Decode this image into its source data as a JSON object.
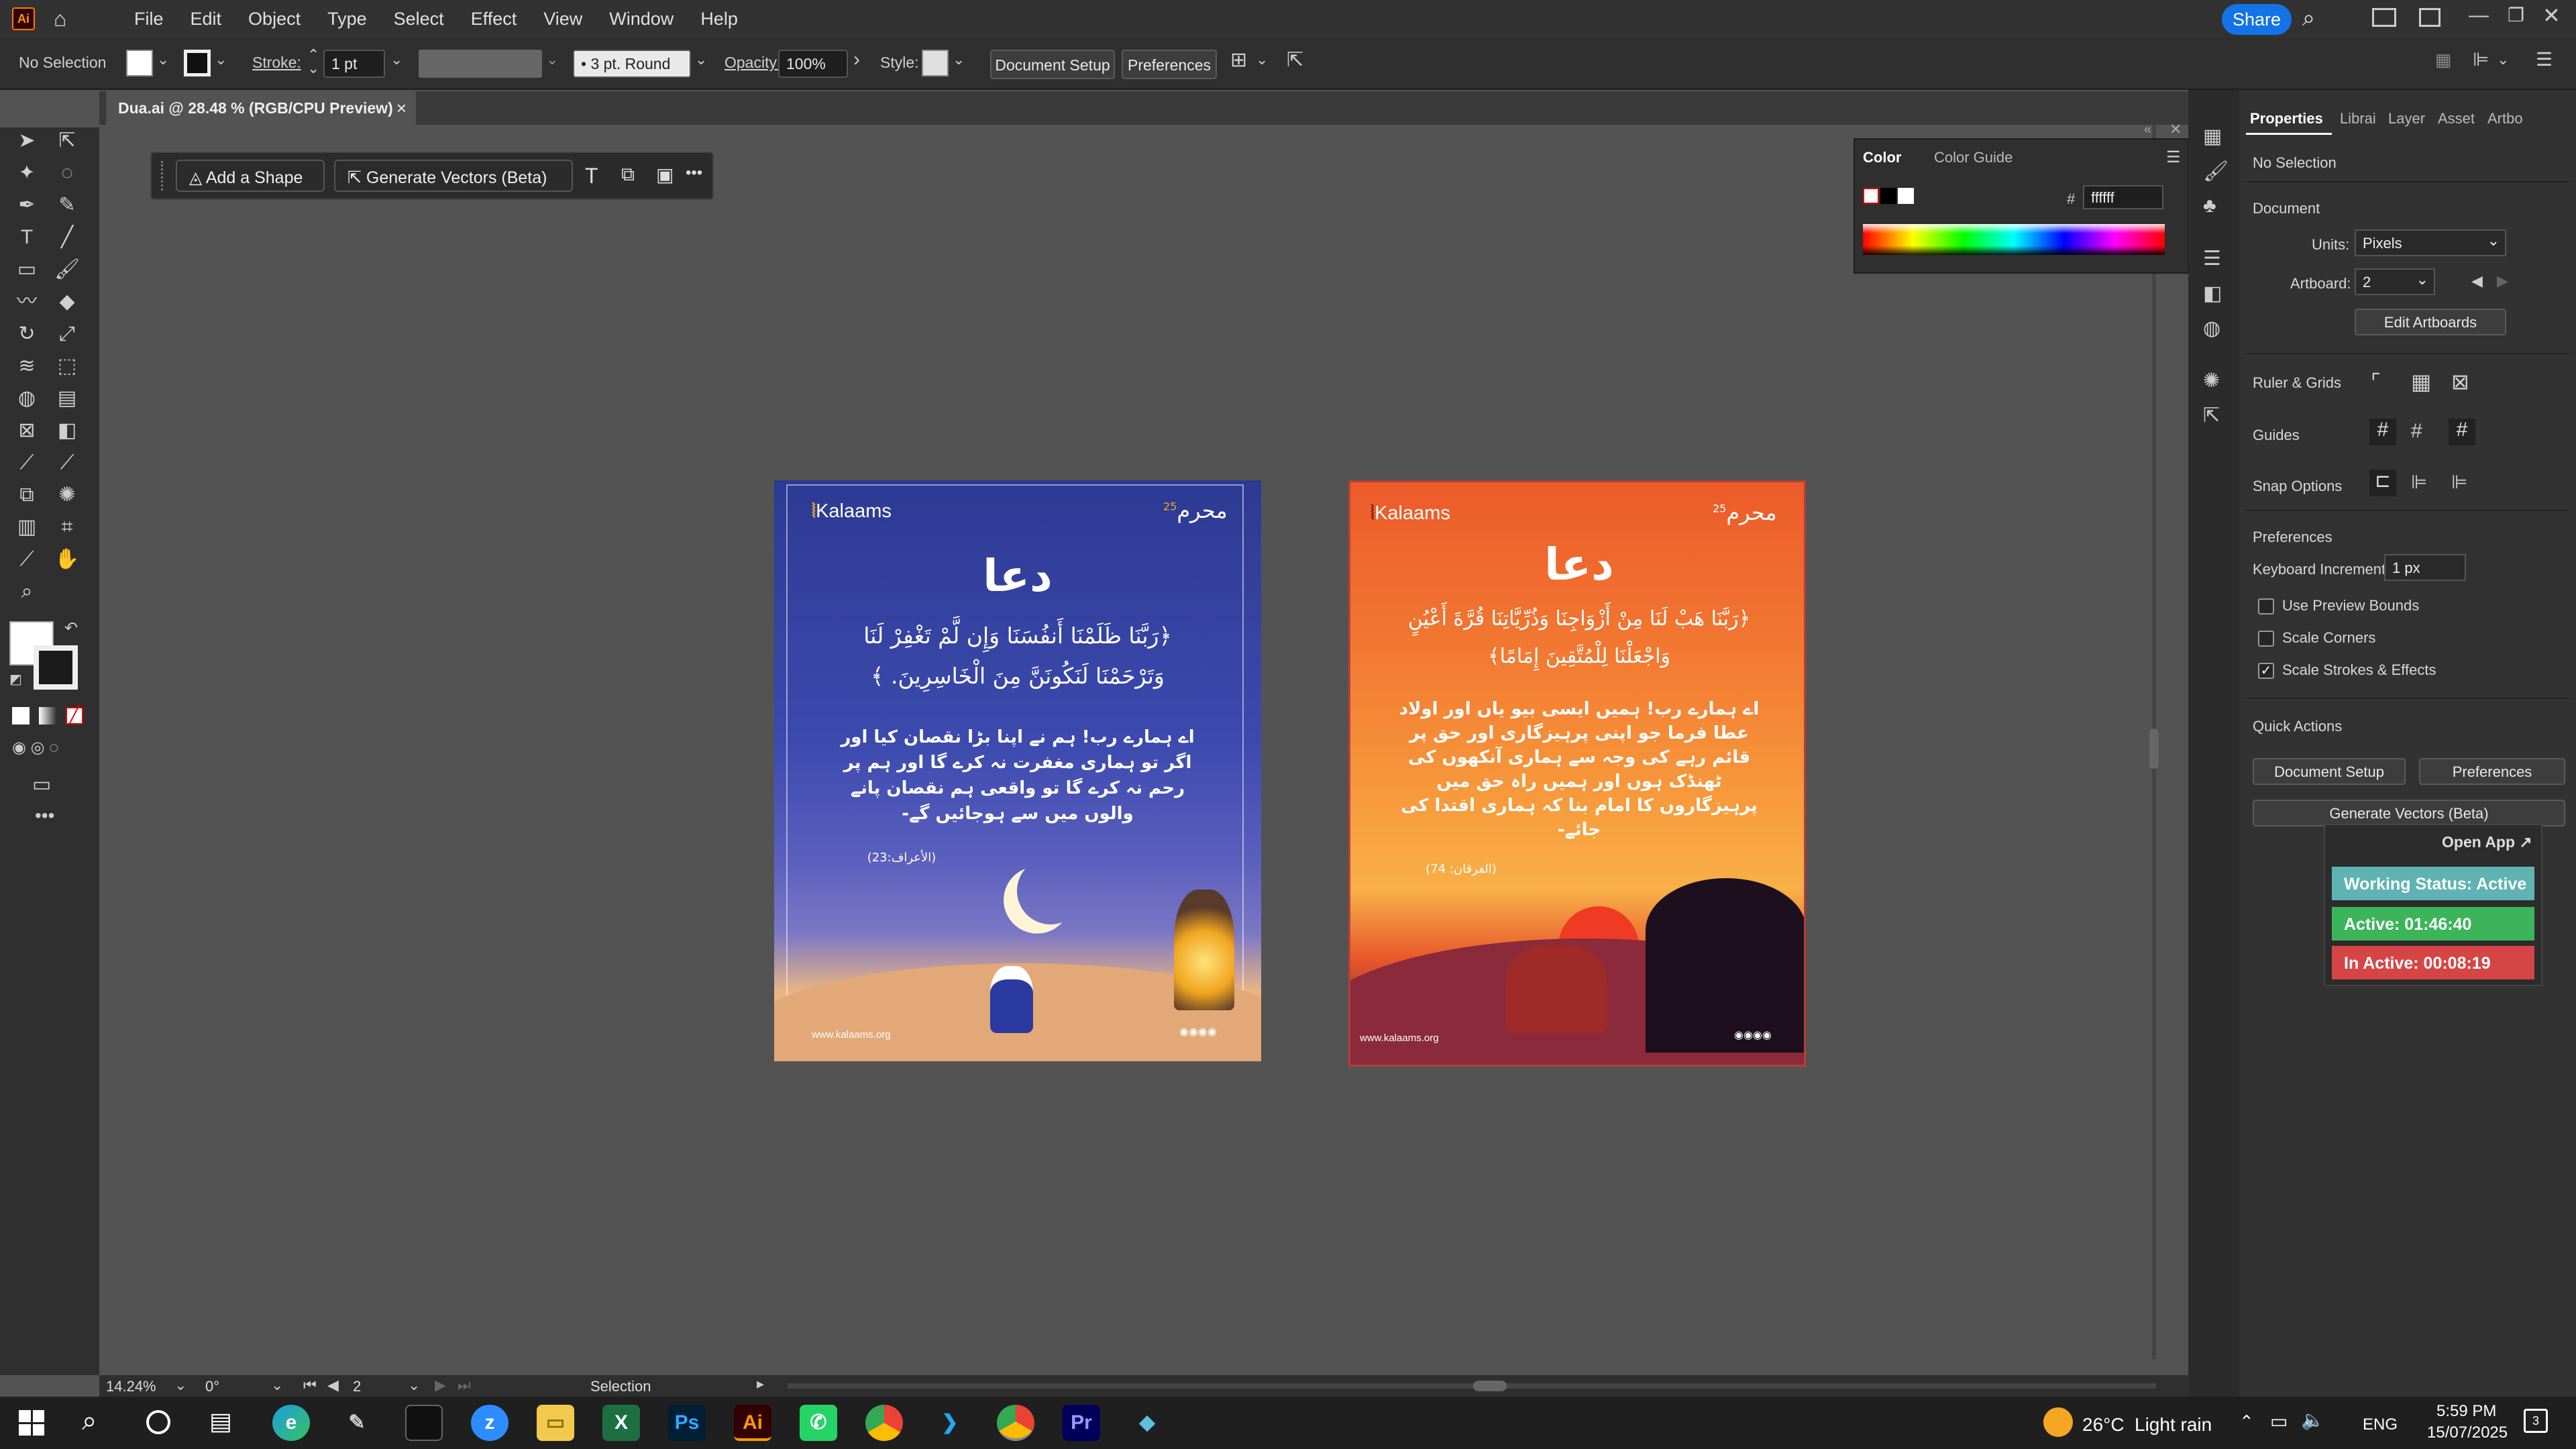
{
  "menu": {
    "app_icon": "Ai",
    "items": [
      "File",
      "Edit",
      "Object",
      "Type",
      "Select",
      "Effect",
      "View",
      "Window",
      "Help"
    ],
    "share_label": "Share"
  },
  "control_bar": {
    "selection": "No Selection",
    "stroke_label": "Stroke:",
    "stroke_value": "1 pt",
    "brush_value": "3 pt. Round",
    "opacity_label": "Opacity:",
    "opacity_value": "100%",
    "style_label": "Style:",
    "document_setup": "Document Setup",
    "preferences": "Preferences"
  },
  "document_tab": {
    "title": "Dua.ai @ 28.48 % (RGB/CPU Preview)",
    "close": "×"
  },
  "context_bar": {
    "add_shape": "Add a Shape",
    "generate_vectors": "Generate Vectors (Beta)",
    "more": "•••"
  },
  "color_panel": {
    "tab_color": "Color",
    "tab_guide": "Color Guide",
    "hex_label": "#",
    "hex_value": "ffffff"
  },
  "artboard1": {
    "logo": "Kalaams",
    "badge": "محرم",
    "badge_num": "25",
    "title": "دعا",
    "arabic_line1": "﴿رَبَّنَا ظَلَمْنَا أَنفُسَنَا وَإِن لَّمْ تَغْفِرْ لَنَا",
    "arabic_line2": "وَتَرْحَمْنَا لَنَكُونَنَّ مِنَ الْخَاسِرِينَ. ﴾",
    "urdu": "اے ہمارے رب! ہم نے اپنا بڑا نقصان کیا اور اگر تو ہماری مغفرت نہ کرے گا اور ہم پر رحم نہ کرے گا تو واقعی ہم نقصان پانے والوں میں سے ہوجائیں گے-",
    "reference": "(الأعراف:23)",
    "website": "www.kalaams.org"
  },
  "artboard2": {
    "logo": "Kalaams",
    "badge": "محرم",
    "badge_num": "25",
    "title": "دعا",
    "arabic_line1": "﴿رَبَّنَا هَبْ لَنَا مِنْ أَزْوَاجِنَا وَذُرِّيَّاتِنَا قُرَّةَ أَعْيُنٍ",
    "arabic_line2": "وَاجْعَلْنَا لِلْمُتَّقِينَ إِمَامًا﴾",
    "urdu": "اے ہمارے رب! ہمیں ایسی بیو یاں اور اولاد عطا فرما جو اپنی پرہیزگاری اور حق پر قائم رہے کی وجہ سے ہماری آنکھوں کی ٹھنڈک ہوں اور ہمیں راہ حق میں پرہیزگاروں کا امام بنا کہ ہماری اقتدا کی جائے-",
    "reference": "(الفرقان: 74)",
    "website": "www.kalaams.org"
  },
  "properties": {
    "tabs": [
      "Properties",
      "Librai",
      "Layer",
      "Asset",
      "Artbo"
    ],
    "no_selection": "No Selection",
    "document": "Document",
    "units_label": "Units:",
    "units_value": "Pixels",
    "artboard_label": "Artboard:",
    "artboard_value": "2",
    "edit_artboards": "Edit Artboards",
    "ruler_grids": "Ruler & Grids",
    "guides": "Guides",
    "snap_options": "Snap Options",
    "preferences_heading": "Preferences",
    "keyboard_increment_label": "Keyboard Increment:",
    "keyboard_increment_value": "1 px",
    "use_preview_bounds": "Use Preview Bounds",
    "scale_corners": "Scale Corners",
    "scale_strokes": "Scale Strokes & Effects",
    "quick_actions": "Quick Actions",
    "document_setup": "Document Setup",
    "preferences": "Preferences",
    "generate_vectors": "Generate Vectors (Beta)"
  },
  "tracker": {
    "open_app": "Open App ↗",
    "working_status": "Working Status: Active",
    "active": "Active: 01:46:40",
    "inactive": "In Active: 00:08:19",
    "colors": {
      "status": "#5fb3b3",
      "active": "#3cb55a",
      "inactive": "#d64545"
    }
  },
  "status_bar": {
    "zoom": "14.24%",
    "rotation": "0°",
    "artboard": "2",
    "tool": "Selection"
  },
  "taskbar": {
    "weather_temp": "26°C",
    "weather_desc": "Light rain",
    "lang": "ENG",
    "time": "5:59 PM",
    "date": "15/07/2025",
    "notif_count": "3"
  }
}
